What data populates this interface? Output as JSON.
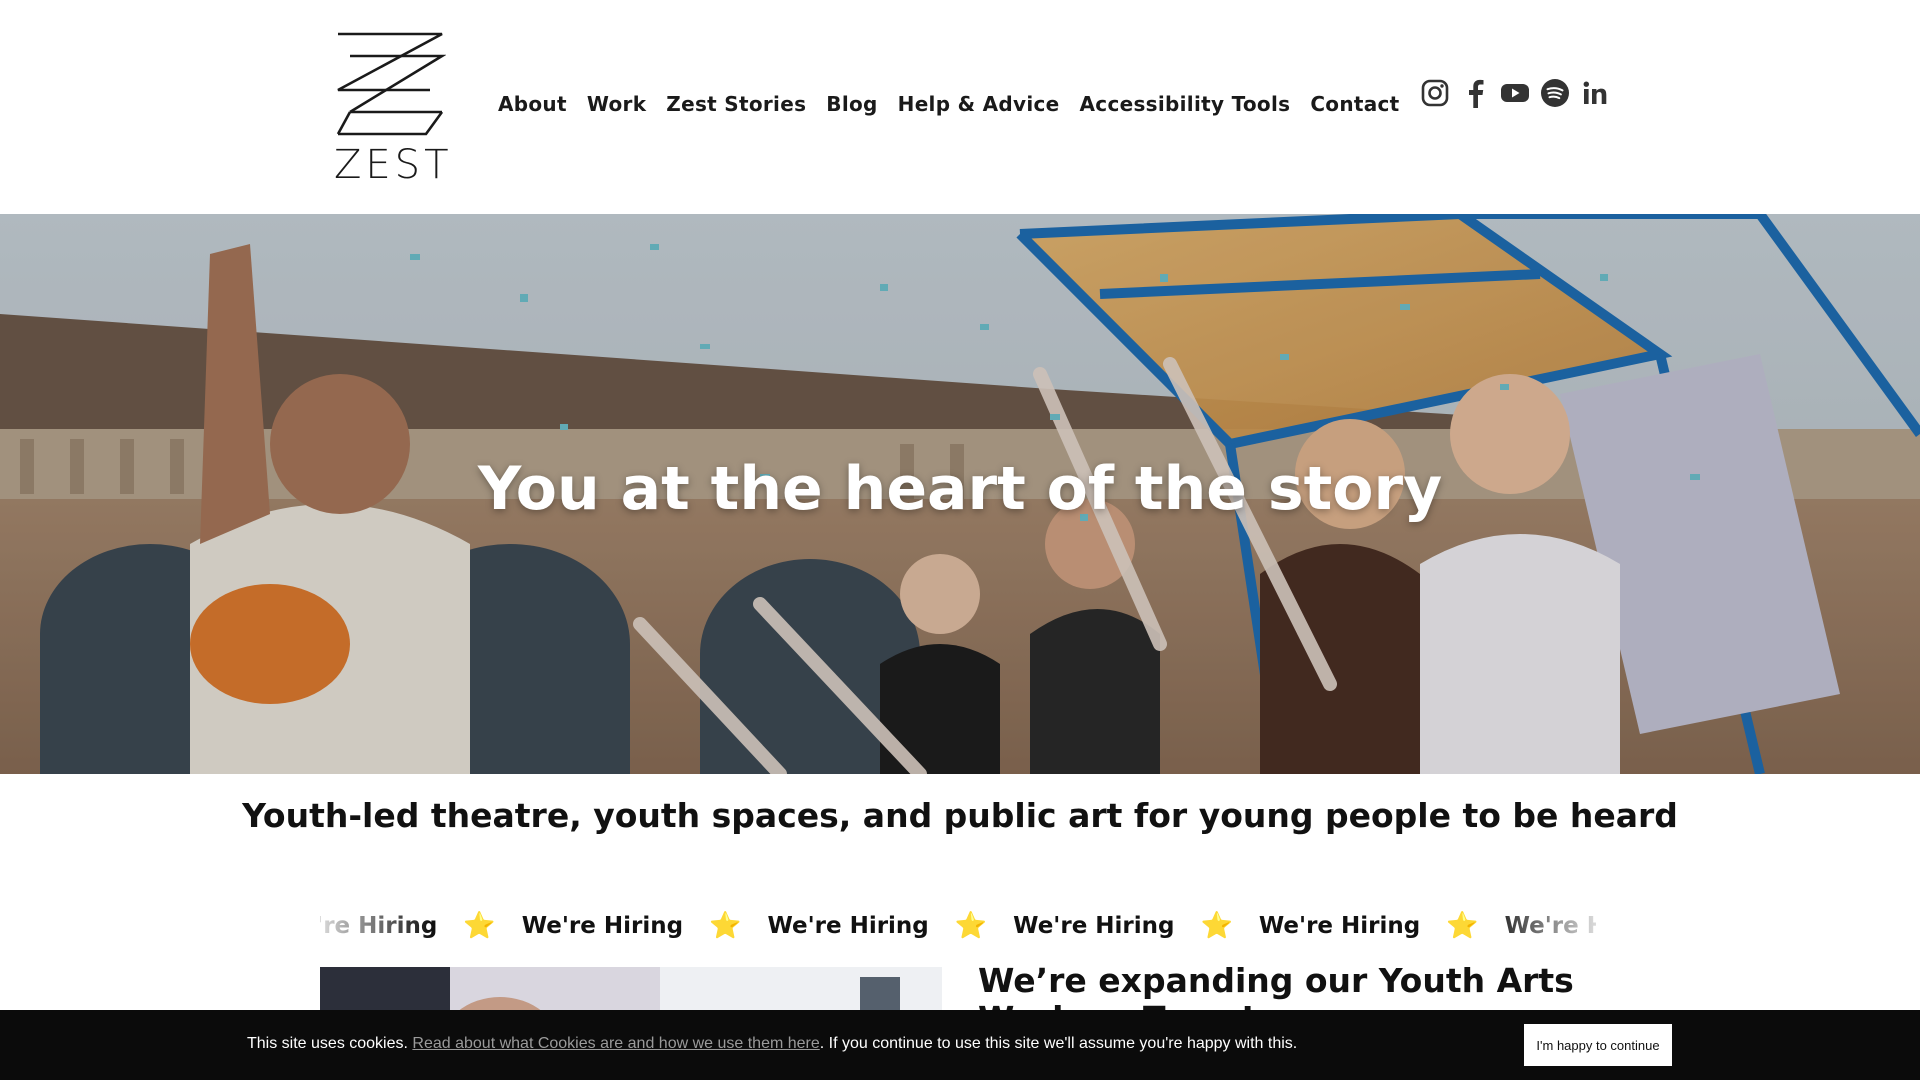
{
  "header": {
    "logo_text": "ZEST",
    "nav": [
      {
        "label": "About"
      },
      {
        "label": "Work"
      },
      {
        "label": "Zest Stories"
      },
      {
        "label": "Blog"
      },
      {
        "label": "Help & Advice"
      },
      {
        "label": "Accessibility Tools"
      },
      {
        "label": "Contact"
      }
    ],
    "social": [
      "instagram-icon",
      "facebook-icon",
      "youtube-icon",
      "spotify-icon",
      "linkedin-icon"
    ]
  },
  "hero": {
    "title": "You at the heart of the story"
  },
  "tagline": "Youth-led theatre, youth spaces, and public art for young people to be heard",
  "marquee": {
    "text": "We're Hiring",
    "star": "⭐"
  },
  "feature": {
    "title": "We’re expanding our Youth Arts Workers Team!"
  },
  "cookie": {
    "text_before": "This site uses cookies. ",
    "link": "Read about what Cookies are and how we use them here",
    "text_after": ". If you continue to use this site we'll assume you're happy with this.",
    "button": "I'm happy to continue"
  },
  "colors": {
    "accent_star": "#f5c518",
    "cookie_bg": "#0b0b0b",
    "scaffold_blue": "#1f6fb5"
  }
}
